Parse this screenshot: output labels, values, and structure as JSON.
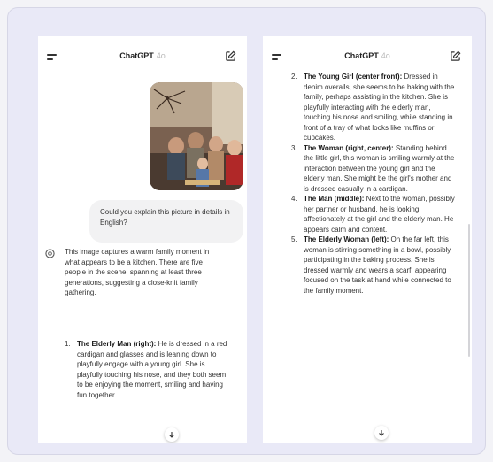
{
  "app": {
    "title": "ChatGPT",
    "version": "4o"
  },
  "left": {
    "user_message": "Could you explain this picture in details in English?",
    "ai_intro": "This image captures a warm family moment in what appears to be a kitchen. There are five people in the scene, spanning at least three generations, suggesting a close-knit family gathering.",
    "items": [
      {
        "num": "1.",
        "title": "The Elderly Man (right):",
        "text": " He is dressed in a red cardigan and glasses and is leaning down to playfully engage with a young girl. She is playfully touching his nose, and they both seem to be enjoying the moment, smiling and having fun together."
      }
    ]
  },
  "right": {
    "items": [
      {
        "num": "2.",
        "title": "The Young Girl (center front):",
        "text": " Dressed in denim overalls, she seems to be baking with the family, perhaps assisting in the kitchen. She is playfully interacting with the elderly man, touching his nose and smiling, while standing in front of a tray of what looks like muffins or cupcakes."
      },
      {
        "num": "3.",
        "title": "The Woman (right, center):",
        "text": " Standing behind the little girl, this woman is smiling warmly at the interaction between the young girl and the elderly man. She might be the girl's mother and is dressed casually in a cardigan."
      },
      {
        "num": "4.",
        "title": "The Man (middle):",
        "text": " Next to the woman, possibly her partner or husband, he is looking affectionately at the girl and the elderly man. He appears calm and content."
      },
      {
        "num": "5.",
        "title": "The Elderly Woman (left):",
        "text": " On the far left, this woman is stirring something in a bowl, possibly participating in the baking process. She is dressed warmly and wears a scarf, appearing focused on the task at hand while connected to the family moment."
      }
    ]
  },
  "icons": {
    "menu": "menu-icon",
    "edit": "edit-icon",
    "assistant": "chatgpt-logo-icon",
    "scroll": "arrow-down-icon"
  }
}
